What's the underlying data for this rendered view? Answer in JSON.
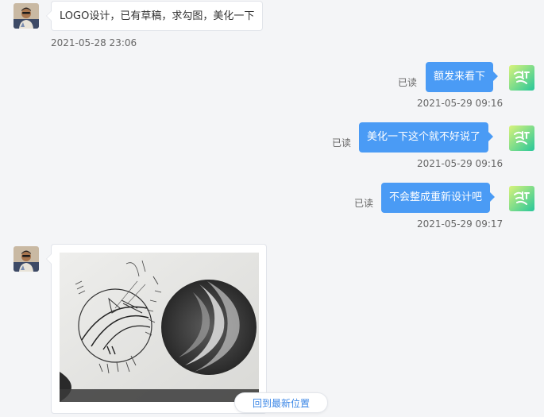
{
  "messages": [
    {
      "text": "LOGO设计，已有草稿，求勾图，美化一下",
      "time": "2021-05-28 23:06"
    },
    {
      "text": "额发来看下",
      "time": "2021-05-29 09:16",
      "status": "已读"
    },
    {
      "text": "美化一下这个就不好说了",
      "time": "2021-05-29 09:16",
      "status": "已读"
    },
    {
      "text": "不会整成重新设计吧",
      "time": "2021-05-29 09:17",
      "status": "已读"
    }
  ],
  "image_message": {
    "alt": "logo-sketch-photo"
  },
  "back_to_latest": "回到最新位置",
  "colors": {
    "background": "#f4f5f7",
    "outgoing_bubble": "#4a9bf5",
    "incoming_bubble": "#ffffff",
    "link": "#3a86e6"
  }
}
